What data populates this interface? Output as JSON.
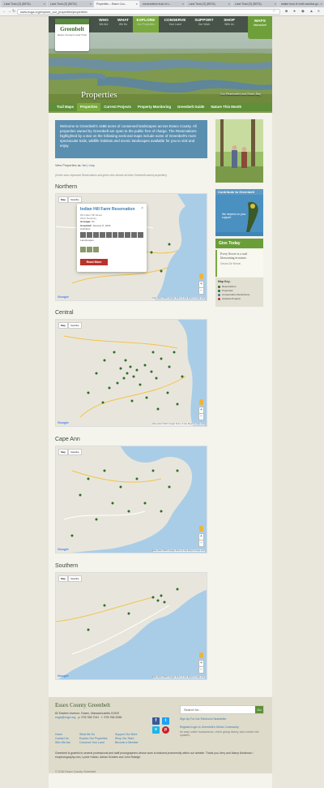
{
  "browser": {
    "tabs": [
      {
        "label": "Land Trust (O) (BETA)",
        "active": false
      },
      {
        "label": "Land Trust (O) (BETA)",
        "active": false
      },
      {
        "label": "Properties – Essex Cou...",
        "active": true
      },
      {
        "label": "conservation trust of n...",
        "active": false
      },
      {
        "label": "Land Trust (O) (BETA)",
        "active": false
      },
      {
        "label": "Land Trust (O) (BETA)",
        "active": false
      },
      {
        "label": "realtor trust of north carolina go...",
        "active": false
      }
    ],
    "url": "www.ecga.org/explore_our_properties/properties/"
  },
  "site": {
    "logo_name": "Greenbelt",
    "logo_tagline": "Essex County's Land Trust",
    "nav": [
      {
        "label": "WHO",
        "sub": "We Are"
      },
      {
        "label": "WHAT",
        "sub": "We Do"
      },
      {
        "label": "EXPLORE",
        "sub": "Our Properties"
      },
      {
        "label": "CONSERVE",
        "sub": "Your Land"
      },
      {
        "label": "SUPPORT",
        "sub": "Our Work"
      },
      {
        "label": "SHOP",
        "sub": "With Us"
      }
    ],
    "maps": {
      "label": "MAPS",
      "sub": "Interactive!"
    },
    "page_title": "Properties",
    "hero_caption": "Cox Reservation and Essex Bay",
    "subnav": [
      "Trail Maps",
      "Properties",
      "Current Projects",
      "Property Monitoring",
      "Greenbelt Guide",
      "Nature This Month"
    ],
    "subnav_current": 1
  },
  "main": {
    "intro": "Welcome to Greenbelt's 1488 acres of conserved landscapes across Essex County. All properties owned by Greenbelt are open to the public free of charge. The Reservations highlighted by a star on the following sectional maps include some of Greenbelt's most spectacular trails, wildlife habitats and scenic landscapes available for you to visit and enjoy.",
    "view_prefix": "View Properties as:",
    "view_list": "list",
    "view_sep": "|",
    "view_map": "map",
    "note": "(Green stars represent Reservations and green dots denote all other Greenbelt owned properties)",
    "regions": [
      "Northern",
      "Central",
      "Cape Ann",
      "Southern"
    ],
    "map_btn_map": "Map",
    "map_btn_sat": "Satellite",
    "google": "Google",
    "map_footer": "Map data ©2016 Google   Terms of Use   Report a map error"
  },
  "infowindow": {
    "title": "Indian Hill Farm Reservation",
    "address1": "86 Indian Hill Street",
    "address2": "West Newbury",
    "acreage_label": "Acreage:",
    "acreage": "94",
    "acquired_label": "Acquired:",
    "acquired": "January 8, 2002",
    "activities_label": "Activities:",
    "landscapes_label": "Landscapes:",
    "read_more": "Read More",
    "close": "×"
  },
  "sidebar": {
    "contribute": "Contribute to Greenbelt",
    "depend": "We depend on your support",
    "give": "Give Today",
    "quote": "Every flower is a soul blossoming in nature.",
    "author": "Gerard De Nerval",
    "mapkey_title": "Map Key:",
    "mapkey": [
      {
        "label": "Reservations",
        "color": "#2f6b2a"
      },
      {
        "label": "Properties",
        "color": "#2f6b2a"
      },
      {
        "label": "Conservation Restrictions",
        "color": "#3a7ab0"
      },
      {
        "label": "Assisted Projects",
        "color": "#b8332a"
      }
    ]
  },
  "footer": {
    "name": "Essex County Greenbelt",
    "address": "82 Eastern Avenue, Essex, Massachusetts 01929",
    "email": "ecga@ecga.org",
    "phone": "p. 978.768.7241",
    "fax": "f. 978.768.3286",
    "links": [
      "Home",
      "What We Do",
      "Support Our Work",
      "Contact Us",
      "Explore Our Properties",
      "Shop Our Store",
      "Who We Are",
      "Conserve Your Land",
      "Become a Member"
    ],
    "search_placeholder": "Search for...",
    "search_btn": "Go",
    "newsletter": "Sign Up For Our Electronic Newsletter",
    "register": "Register/Login to Greenbelt's Online Community",
    "register_note": "for easy online transactions, check giving history and contact info updates.",
    "credit": "Greenbelt is grateful to several professional and staff photographers whose work is featured prominently within our website. Thank you Jerry and Marcy Monkman / ecophotography.com, Lynne Hutton, Adrian Scholes and John Raleigh.",
    "copyright": "© 2016 Essex County Greenbelt"
  }
}
